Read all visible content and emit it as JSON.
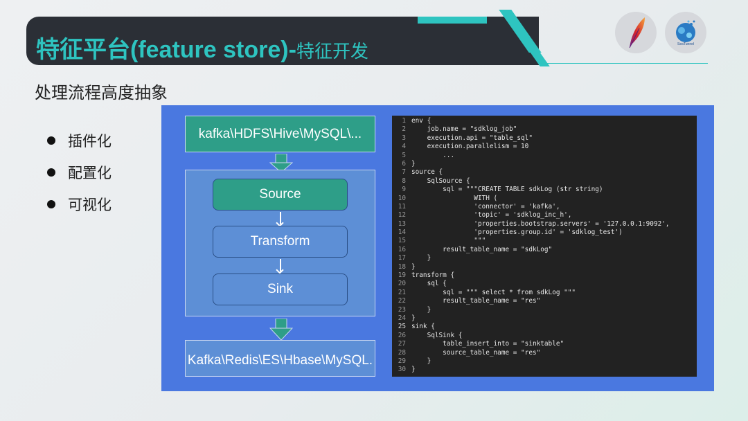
{
  "header": {
    "title_main": "特征平台(feature store)-",
    "title_sub": "特征开发",
    "logo_right_text": "SeaTunnel"
  },
  "subtitle": "处理流程高度抽象",
  "bullets": [
    "插件化",
    "配置化",
    "可视化"
  ],
  "diagram": {
    "source_box": "kafka\\HDFS\\Hive\\MySQL\\...",
    "stages": [
      "Source",
      "Transform",
      "Sink"
    ],
    "dest_box": "Kafka\\Redis\\ES\\Hbase\\MySQL."
  },
  "code": {
    "lines": [
      "env {",
      "    job.name = \"sdklog_job\"",
      "    execution.api = \"table_sql\"",
      "    execution.parallelism = 10",
      "        ...",
      "}",
      "source {",
      "    SqlSource {",
      "        sql = \"\"\"CREATE TABLE sdkLog (str string)",
      "                WITH (",
      "                'connector' = 'kafka',",
      "                'topic' = 'sdklog_inc_h',",
      "                'properties.bootstrap.servers' = '127.0.0.1:9092',",
      "                'properties.group.id' = 'sdklog_test')",
      "                \"\"\"",
      "        result_table_name = \"sdkLog\"",
      "    }",
      "}",
      "transform {",
      "    sql {",
      "        sql = \"\"\" select * from sdkLog \"\"\"",
      "        result_table_name = \"res\"",
      "    }",
      "}",
      "sink {",
      "    SqlSink {",
      "        table_insert_into = \"sinktable\"",
      "        source_table_name = \"res\"",
      "    }",
      "}"
    ],
    "highlighted_line": 25
  },
  "colors": {
    "accent": "#2ec4c0",
    "panel_blue": "#4a78e0",
    "box_green": "#2e9e88",
    "box_blue": "#5d8fd6"
  }
}
